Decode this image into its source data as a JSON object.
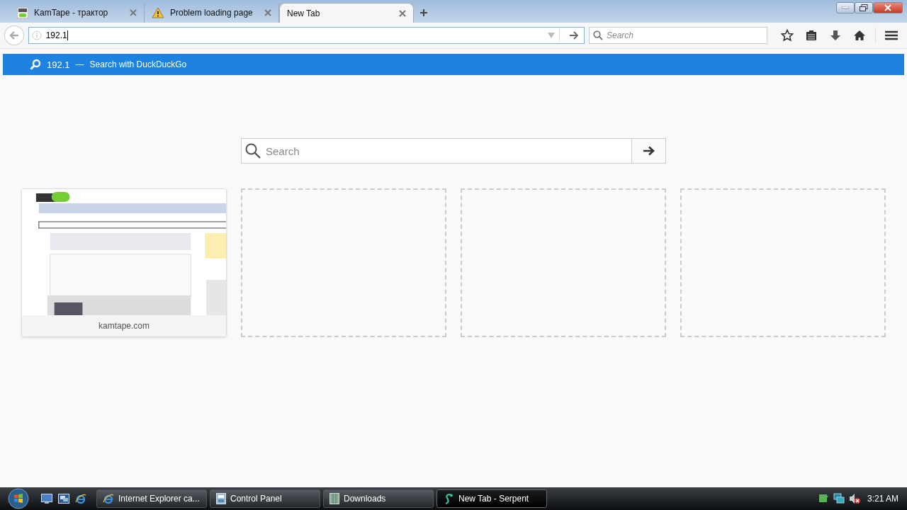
{
  "tabs": [
    {
      "title": "KamTape - трактор",
      "selected": false
    },
    {
      "title": "Problem loading page",
      "selected": false
    },
    {
      "title": "New Tab",
      "selected": true
    }
  ],
  "url_bar": {
    "value": "192.1"
  },
  "search_bar": {
    "placeholder": "Search"
  },
  "suggestion": {
    "query": "192.1",
    "separator": "—",
    "action": "Search with DuckDuckGo",
    "selected": true
  },
  "page_search": {
    "placeholder": "Search"
  },
  "tiles": [
    {
      "kind": "site",
      "label": "kamtape.com"
    },
    {
      "kind": "empty"
    },
    {
      "kind": "empty"
    },
    {
      "kind": "empty"
    }
  ],
  "taskbar": {
    "items": [
      {
        "label": "Internet Explorer ca...",
        "selected": false
      },
      {
        "label": "Control Panel",
        "selected": false
      },
      {
        "label": "Downloads",
        "selected": false
      },
      {
        "label": "New Tab - Serpent",
        "selected": true
      }
    ],
    "clock": "3:21 AM"
  }
}
